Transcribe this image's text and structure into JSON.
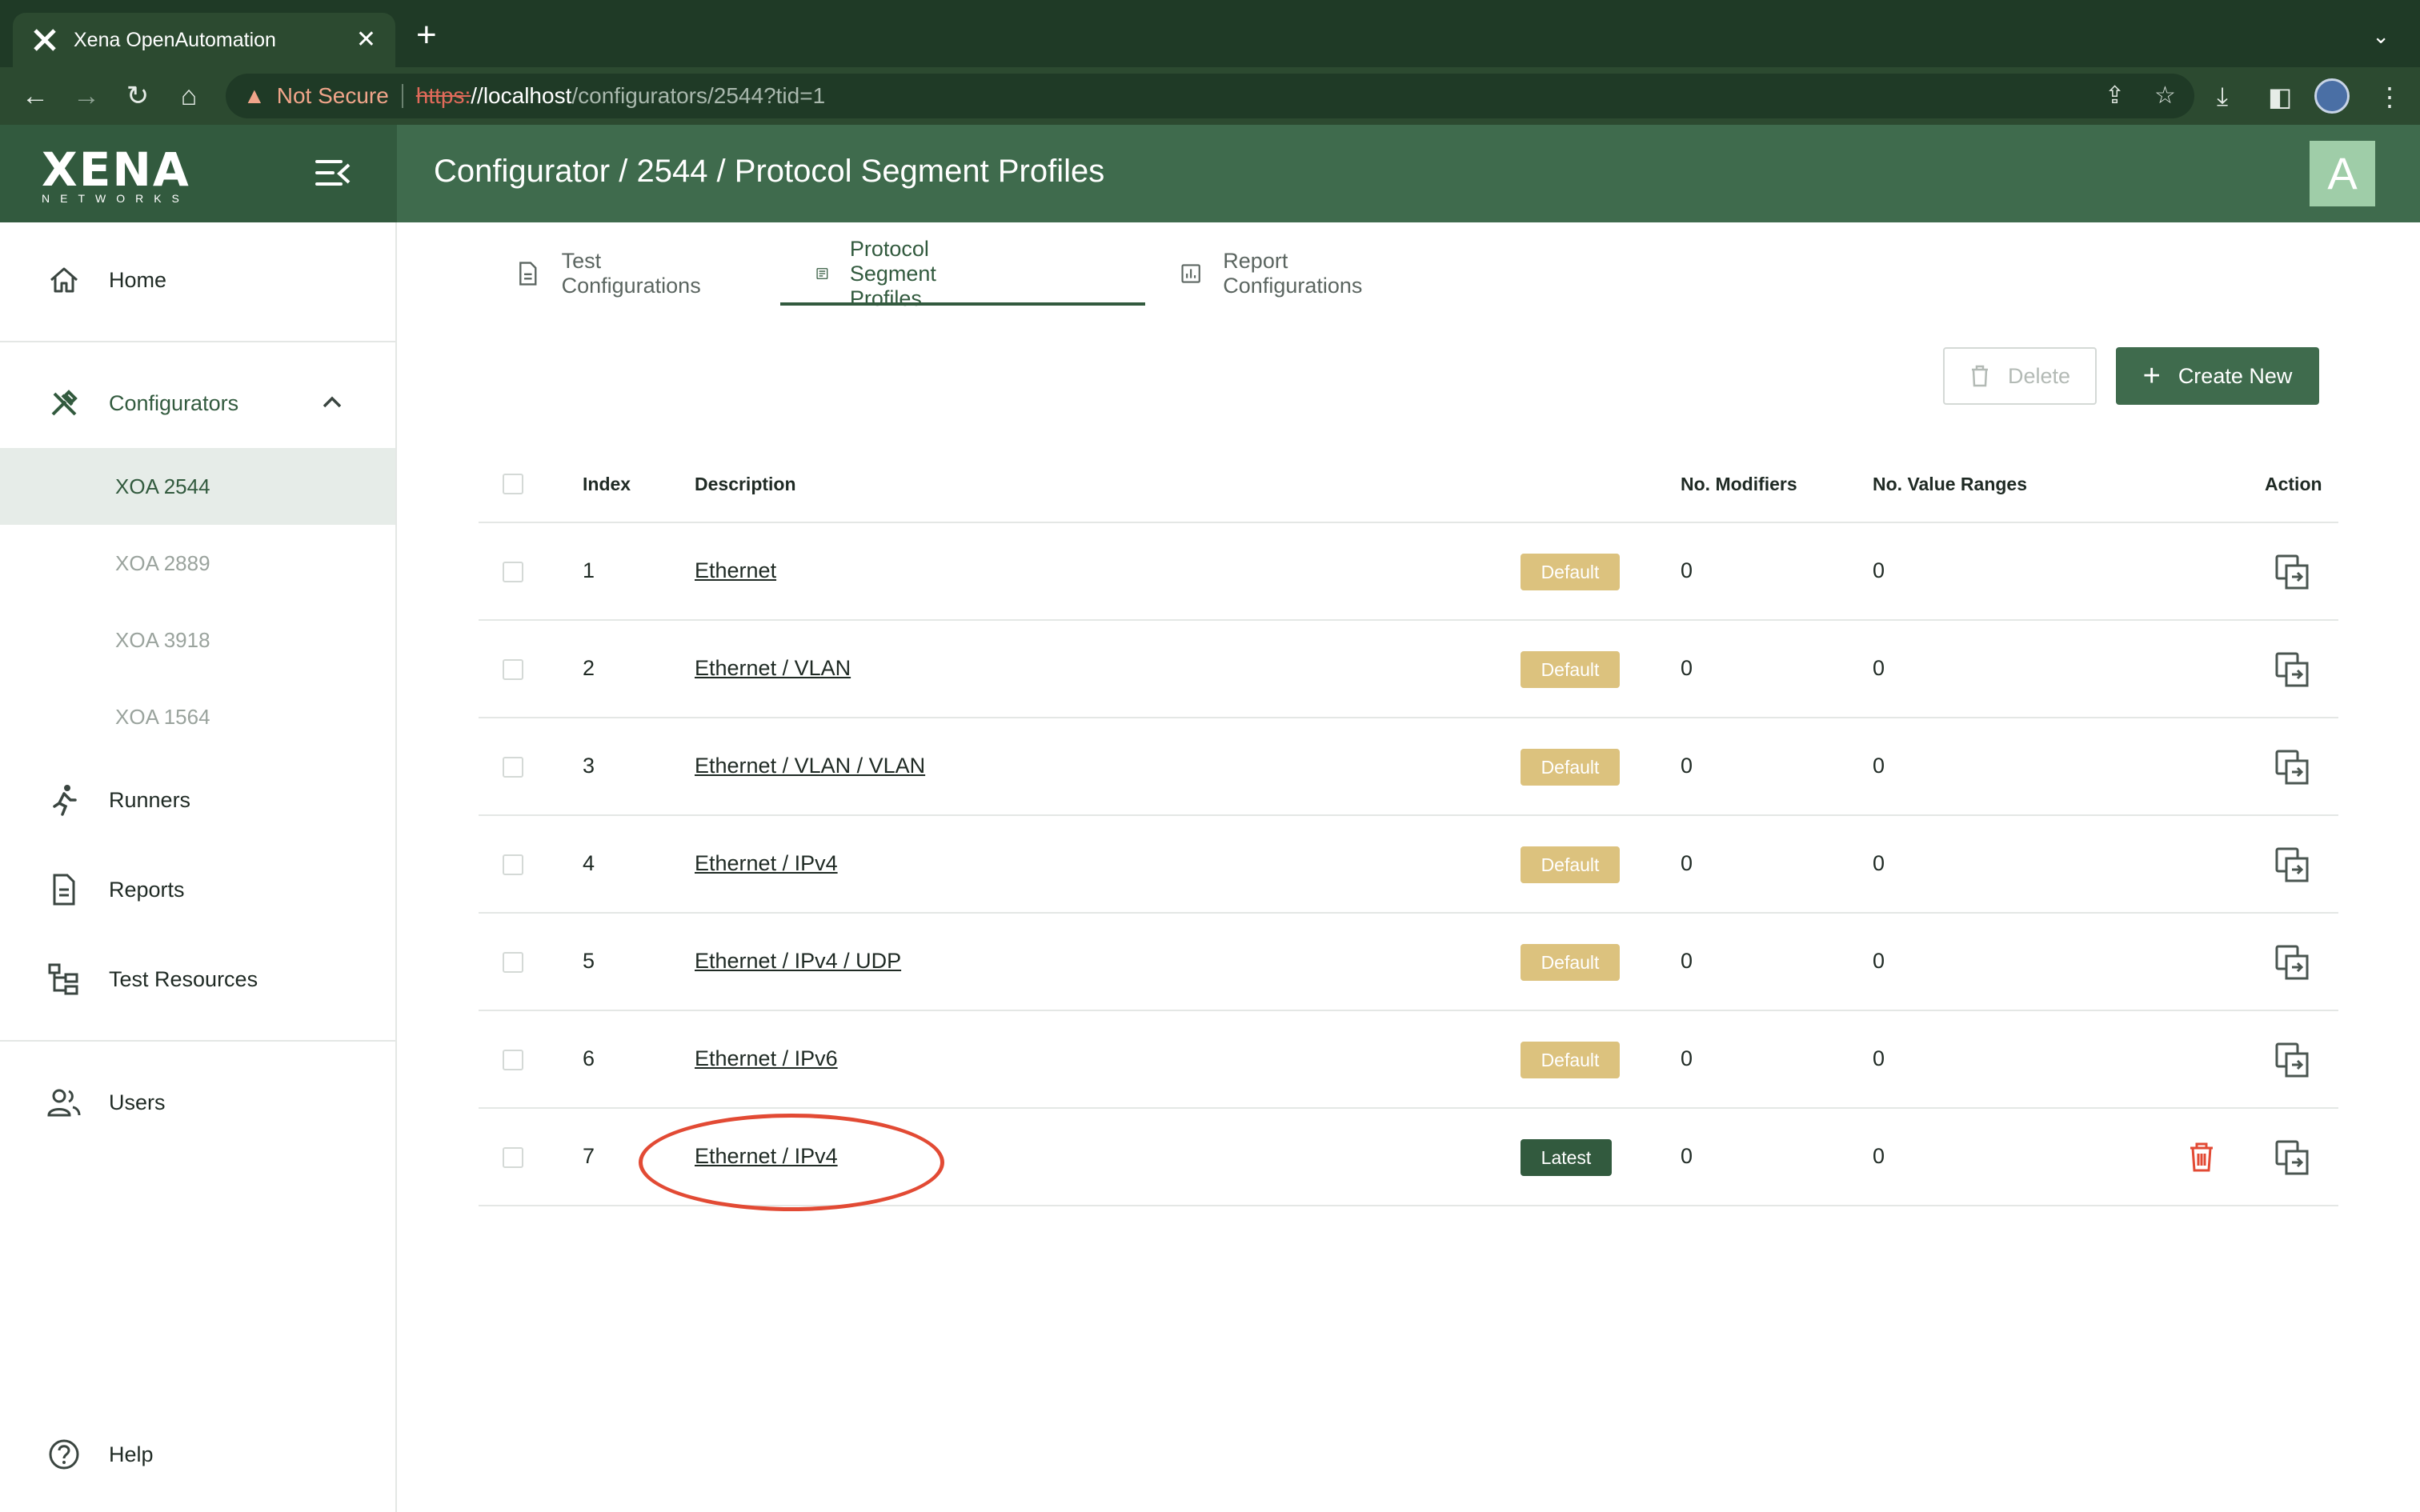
{
  "browser": {
    "tab_title": "Xena OpenAutomation",
    "security_label": "Not Secure",
    "url_scheme": "https:",
    "url_host": "//localhost",
    "url_path": "/configurators/2544?tid=1"
  },
  "header": {
    "logo_text": "XENA",
    "logo_sub": "NETWORKS",
    "breadcrumb": "Configurator / 2544 / Protocol Segment Profiles",
    "avatar_initial": "A"
  },
  "sidebar": {
    "home": "Home",
    "configurators": "Configurators",
    "configurator_items": [
      "XOA 2544",
      "XOA 2889",
      "XOA 3918",
      "XOA 1564"
    ],
    "active_configurator": "XOA 2544",
    "runners": "Runners",
    "reports": "Reports",
    "test_resources": "Test Resources",
    "users": "Users",
    "help": "Help"
  },
  "tabs": [
    {
      "label": "Test Configurations",
      "icon": "document-icon",
      "active": false
    },
    {
      "label": "Protocol Segment Profiles",
      "icon": "list-doc-icon",
      "active": true
    },
    {
      "label": "Report Configurations",
      "icon": "bar-chart-icon",
      "active": false
    }
  ],
  "actions": {
    "delete_label": "Delete",
    "create_label": "Create New"
  },
  "table": {
    "columns": {
      "index": "Index",
      "description": "Description",
      "modifiers": "No. Modifiers",
      "value_ranges": "No. Value Ranges",
      "action": "Action"
    },
    "rows": [
      {
        "index": "1",
        "description": "Ethernet",
        "badge": "Default",
        "modifiers": "0",
        "value_ranges": "0"
      },
      {
        "index": "2",
        "description": "Ethernet / VLAN",
        "badge": "Default",
        "modifiers": "0",
        "value_ranges": "0"
      },
      {
        "index": "3",
        "description": "Ethernet / VLAN / VLAN",
        "badge": "Default",
        "modifiers": "0",
        "value_ranges": "0"
      },
      {
        "index": "4",
        "description": "Ethernet / IPv4",
        "badge": "Default",
        "modifiers": "0",
        "value_ranges": "0"
      },
      {
        "index": "5",
        "description": "Ethernet / IPv4 / UDP",
        "badge": "Default",
        "modifiers": "0",
        "value_ranges": "0"
      },
      {
        "index": "6",
        "description": "Ethernet / IPv6",
        "badge": "Default",
        "modifiers": "0",
        "value_ranges": "0"
      },
      {
        "index": "7",
        "description": "Ethernet / IPv4",
        "badge": "Latest",
        "modifiers": "0",
        "value_ranges": "0"
      }
    ]
  },
  "colors": {
    "brand_dark": "#325a3e",
    "brand": "#3f6b4d",
    "default_badge": "#dcc27e",
    "danger": "#e24a34"
  }
}
